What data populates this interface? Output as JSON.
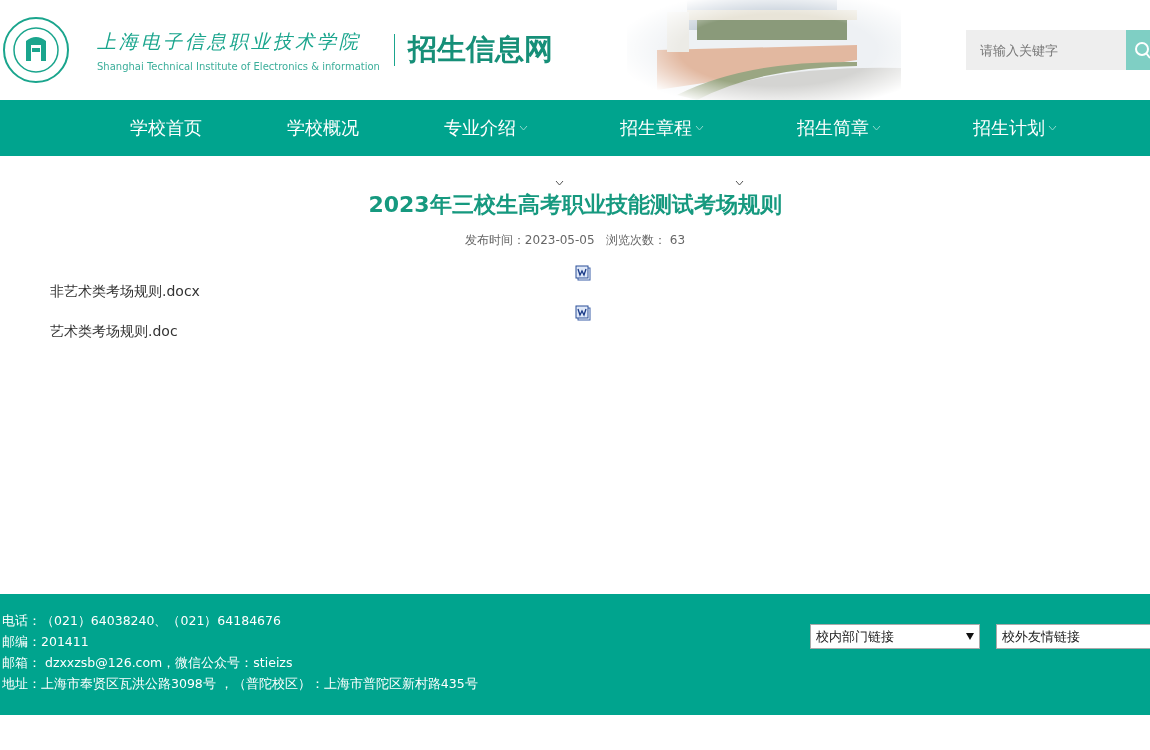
{
  "header": {
    "school_name_cn": "上海电子信息职业技术学院",
    "school_name_en": "Shanghai Technical Institute of Electronics & information",
    "site_title": "招生信息网",
    "search": {
      "placeholder": "请输入关键字"
    }
  },
  "nav": [
    {
      "label": "学校首页",
      "has_dropdown": false
    },
    {
      "label": "学校概况",
      "has_dropdown": false
    },
    {
      "label": "专业介绍",
      "has_dropdown": true
    },
    {
      "label": "招生章程",
      "has_dropdown": true
    },
    {
      "label": "招生简章",
      "has_dropdown": true
    },
    {
      "label": "招生计划",
      "has_dropdown": true
    }
  ],
  "article": {
    "title": "2023年三校生高考职业技能测试考场规则",
    "meta": "发布时间：2023-05-05   浏览次数： 63",
    "attachments": [
      {
        "name": "非艺术类考场规则.docx"
      },
      {
        "name": "艺术类考场规则.doc"
      }
    ]
  },
  "footer": {
    "lines": [
      "电话：（021）64038240、（021）64184676",
      "邮编：201411",
      "邮箱： dzxxzsb@126.com，微信公众号：stieizs",
      "地址：上海市奉贤区瓦洪公路3098号 ，（普陀校区）：上海市普陀区新村路435号"
    ],
    "selects": [
      {
        "value": "校内部门链接"
      },
      {
        "value": "校外友情链接"
      }
    ]
  }
}
